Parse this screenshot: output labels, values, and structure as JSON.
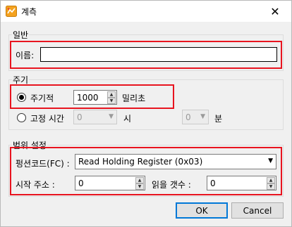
{
  "window": {
    "title": "계측",
    "close_glyph": "✕"
  },
  "general": {
    "group_title": "일반",
    "name_label": "이름:",
    "name_value": ""
  },
  "period": {
    "group_title": "주기",
    "periodic_label": "주기적",
    "periodic_value": "1000",
    "periodic_unit": "밀리초",
    "fixed_label": "고정 시간",
    "fixed_hour_value": "0",
    "fixed_hour_unit": "시",
    "fixed_minute_value": "0",
    "fixed_minute_unit": "분"
  },
  "range": {
    "group_title": "범위 설정",
    "function_label": "펑션코드(FC) :",
    "function_value": "Read Holding Register (0x03)",
    "start_label": "시작 주소 :",
    "start_value": "0",
    "count_label": "읽을 갯수 :",
    "count_value": "0"
  },
  "buttons": {
    "ok": "OK",
    "cancel": "Cancel"
  },
  "icons": {
    "app": "app-icon",
    "close": "close-icon",
    "spin_up": "▲",
    "spin_down": "▼",
    "dropdown": "▼"
  },
  "colors": {
    "highlight": "#e8141f",
    "accent": "#0078d7"
  }
}
